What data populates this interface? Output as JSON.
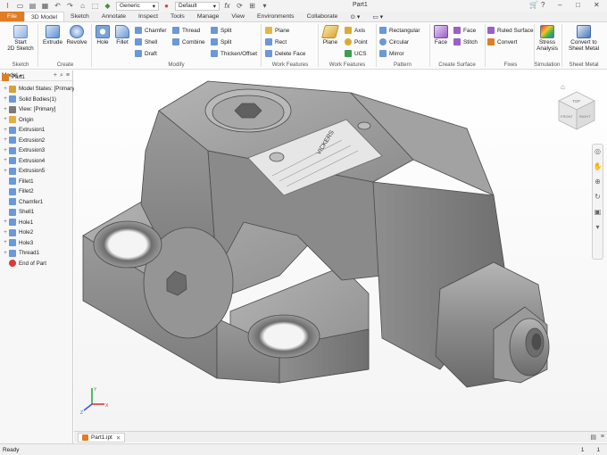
{
  "titlebar": {
    "app_menu": "File",
    "appearance": "Generic",
    "design_view": "Default",
    "document_title": "Part1"
  },
  "tabs": [
    "File",
    "3D Model",
    "Sketch",
    "Annotate",
    "Inspect",
    "Tools",
    "Manage",
    "View",
    "Environments",
    "Collaborate"
  ],
  "ribbon": {
    "sketch": {
      "start": "Start",
      "sketch2d": "2D Sketch",
      "panel": "Sketch"
    },
    "create": {
      "extrude": "Extrude",
      "revolve": "Revolve",
      "panel": "Create"
    },
    "modify": {
      "hole": "Hole",
      "fillet": "Fillet",
      "chamfer": "Chamfer",
      "shell": "Shell",
      "draft": "Draft",
      "thread": "Thread",
      "combine": "Combine",
      "split1": "Split",
      "split2": "Split",
      "thicken": "Thicken/Offset",
      "panel": "Modify"
    },
    "explore": {
      "plane_s": "Plane",
      "rect": "Rect",
      "delete_face": "Delete Face",
      "panel": "Work Features"
    },
    "work": {
      "plane": "Plane",
      "axis": "Axis",
      "point": "Point",
      "ucs": "UCS",
      "panel": "Work Features"
    },
    "pattern": {
      "rectangular": "Rectangular",
      "circular": "Circular",
      "mirror": "Mirror",
      "panel": "Pattern"
    },
    "freeform": {
      "face": "Face",
      "face2": "Face",
      "stitch": "Stitch",
      "panel": "Create Surface"
    },
    "surface": {
      "ruled": "Ruled Surface",
      "convert": "Convert",
      "panel": "Fixes"
    },
    "simulation": {
      "stress": "Stress",
      "analysis": "Analysis",
      "panel": "Simulation"
    },
    "sheetmetal": {
      "convert1": "Convert to",
      "convert2": "Sheet Metal",
      "panel": "Sheet Metal"
    }
  },
  "browser": {
    "tab": "Model",
    "root": "Part1",
    "items": [
      "Model States: [Primary]",
      "Solid Bodies(1)",
      "View: [Primary]",
      "Origin",
      "Extrusion1",
      "Extrusion2",
      "Extrusion3",
      "Extrusion4",
      "Extrusion5",
      "Fillet1",
      "Fillet2",
      "Chamfer1",
      "Shell1",
      "Hole1",
      "Hole2",
      "Hole3",
      "Thread1",
      "End of Part"
    ]
  },
  "viewcube": {
    "top": "TOP",
    "front": "FRONT",
    "right": "RIGHT"
  },
  "triad": {
    "x": "X",
    "y": "Y",
    "z": "Z"
  },
  "document_tab": "Part1.ipt",
  "status": "Ready",
  "status_numbers": [
    "1",
    "1"
  ],
  "nameplate": {
    "line1": "VICKERS"
  },
  "colors": {
    "file_tab": "#e07c22",
    "accent": "#2a6fc9",
    "part": "#8c8c8c"
  }
}
